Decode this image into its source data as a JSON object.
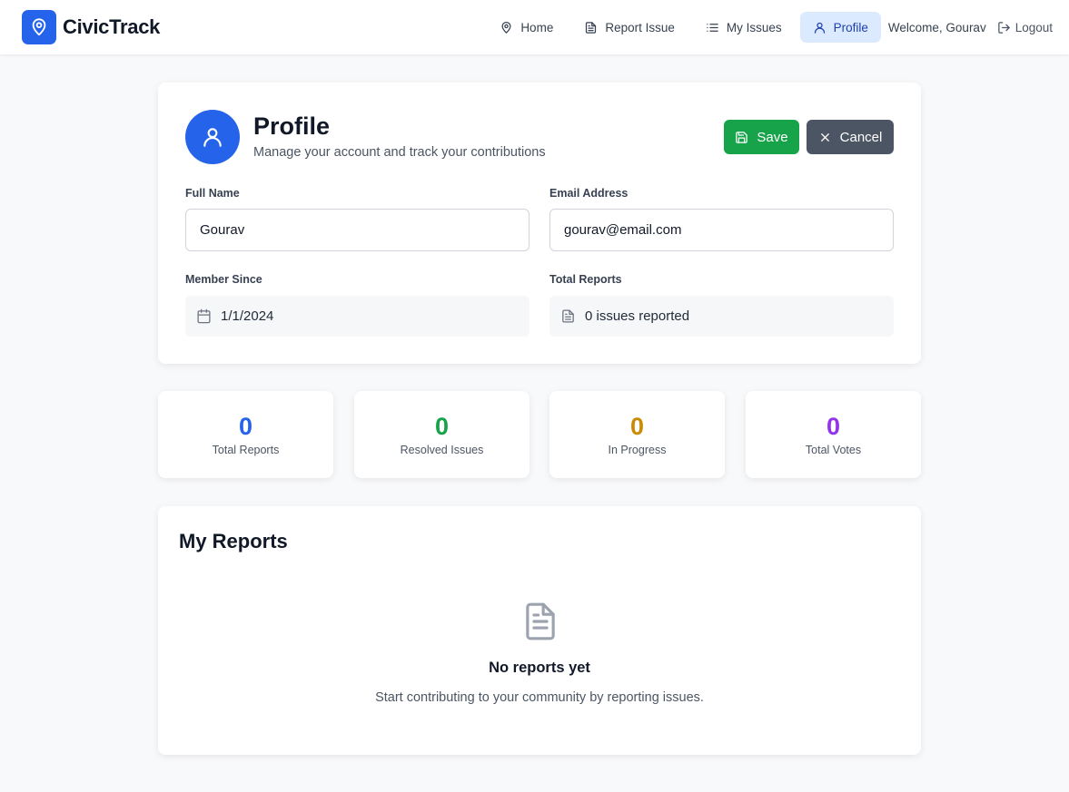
{
  "app": {
    "name": "CivicTrack",
    "brand_color": "#2563eb"
  },
  "nav": {
    "items": [
      {
        "label": "Home",
        "icon": "map-pin-icon",
        "active": false
      },
      {
        "label": "Report Issue",
        "icon": "file-text-icon",
        "active": false
      },
      {
        "label": "My Issues",
        "icon": "list-icon",
        "active": false
      },
      {
        "label": "Profile",
        "icon": "user-icon",
        "active": true
      }
    ],
    "welcome": "Welcome, Gourav",
    "logout": "Logout"
  },
  "profile": {
    "title": "Profile",
    "subtitle": "Manage your account and track your contributions",
    "save_label": "Save",
    "cancel_label": "Cancel",
    "fields": {
      "full_name": {
        "label": "Full Name",
        "value": "Gourav"
      },
      "email": {
        "label": "Email Address",
        "value": "gourav@email.com"
      },
      "member_since": {
        "label": "Member Since",
        "value": "1/1/2024"
      },
      "total_reports": {
        "label": "Total Reports",
        "value": "0 issues reported"
      }
    }
  },
  "stats": [
    {
      "value": "0",
      "label": "Total Reports",
      "color": "#2563eb"
    },
    {
      "value": "0",
      "label": "Resolved Issues",
      "color": "#16a34a"
    },
    {
      "value": "0",
      "label": "In Progress",
      "color": "#ca8a04"
    },
    {
      "value": "0",
      "label": "Total Votes",
      "color": "#9333ea"
    }
  ],
  "reports": {
    "title": "My Reports",
    "empty_title": "No reports yet",
    "empty_subtitle": "Start contributing to your community by reporting issues."
  }
}
